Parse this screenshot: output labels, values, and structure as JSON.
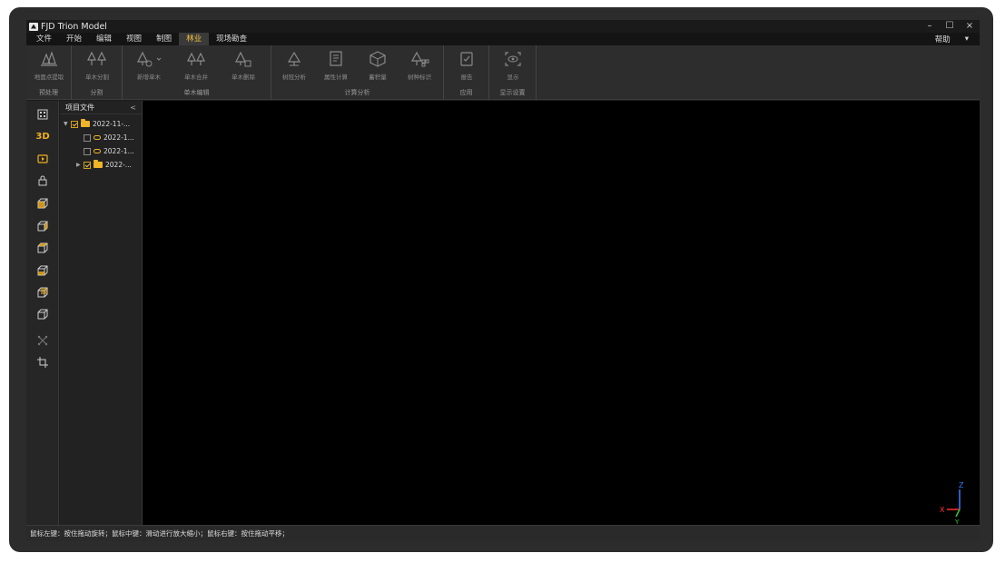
{
  "window": {
    "title": "FJD Trion Model",
    "controls": {
      "minimize": "–",
      "maximize": "☐",
      "close": "×"
    }
  },
  "menubar": {
    "items": [
      "文件",
      "开始",
      "编辑",
      "视图",
      "制图",
      "林业",
      "现场勘查"
    ],
    "active_index": 5,
    "help": "帮助",
    "dropdown": "▾"
  },
  "ribbon": {
    "groups": [
      {
        "label": "预处理",
        "buttons": [
          {
            "label": "地面点提取",
            "icon": "ground-extract-icon"
          }
        ]
      },
      {
        "label": "分割",
        "buttons": [
          {
            "label": "单木分割",
            "icon": "tree-segment-icon"
          }
        ]
      },
      {
        "label": "单木编辑",
        "buttons": [
          {
            "label": "新增单木",
            "icon": "add-tree-icon"
          },
          {
            "label": "单木合并",
            "icon": "merge-tree-icon"
          },
          {
            "label": "单木删除",
            "icon": "delete-tree-icon"
          }
        ]
      },
      {
        "label": "计算分析",
        "buttons": [
          {
            "label": "树冠分析",
            "icon": "crown-analysis-icon"
          },
          {
            "label": "属性计算",
            "icon": "attribute-calc-icon"
          },
          {
            "label": "蓄积量",
            "icon": "volume-icon"
          },
          {
            "label": "树种标识",
            "icon": "species-label-icon"
          }
        ]
      },
      {
        "label": "应用",
        "buttons": [
          {
            "label": "报告",
            "icon": "report-icon"
          }
        ]
      },
      {
        "label": "显示设置",
        "buttons": [
          {
            "label": "显示",
            "icon": "display-icon"
          }
        ]
      }
    ]
  },
  "sidebar": {
    "mode_label": "3D",
    "icons": [
      "grid-view-icon",
      "3d-mode-icon",
      "camera-view-icon",
      "lock-icon",
      "view-front-icon",
      "view-back-icon",
      "view-left-icon",
      "view-right-icon",
      "view-top-icon",
      "view-bottom-icon",
      "measure-icon",
      "crop-icon"
    ]
  },
  "project_panel": {
    "title": "项目文件",
    "collapse": "<",
    "tree": [
      {
        "label": "2022-11-...",
        "type": "folder",
        "checked": true,
        "expanded": true
      },
      {
        "label": "2022-1...",
        "type": "cloud",
        "checked": false
      },
      {
        "label": "2022-1...",
        "type": "cloud",
        "checked": false
      },
      {
        "label": "2022-...",
        "type": "folder",
        "checked": true,
        "expanded": false
      }
    ]
  },
  "viewport": {
    "axes": {
      "z": "Z",
      "x": "X",
      "y": "Y"
    },
    "colors": {
      "z": "#3a7bff",
      "x": "#ff3030",
      "y": "#30d030"
    }
  },
  "statusbar": {
    "text": "鼠标左键：按住拖动旋转；鼠标中键：滑动进行放大缩小；鼠标右键：按住拖动平移；"
  },
  "colors": {
    "accent": "#f0c040",
    "ribbon_bg": "#2d2d2d",
    "viewport_bg": "#000000"
  }
}
